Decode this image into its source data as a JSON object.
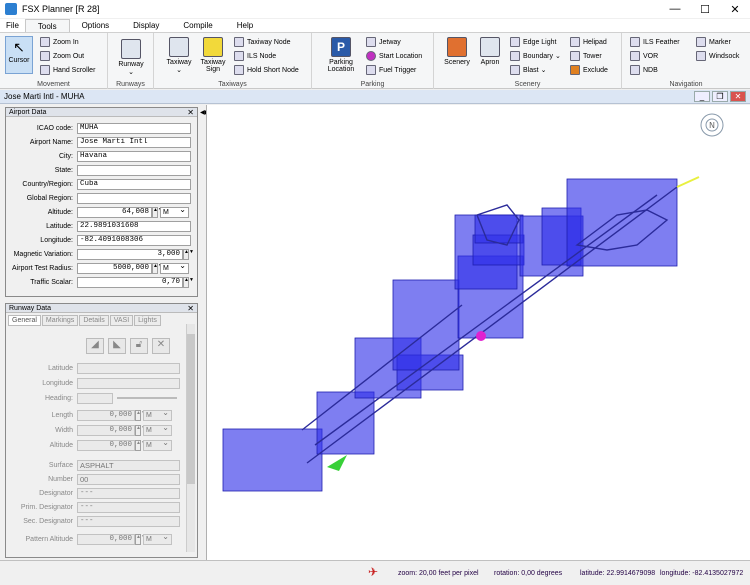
{
  "window": {
    "title": "FSX Planner [R 28]",
    "min": "—",
    "max": "☐",
    "close": "✕"
  },
  "menu": [
    "File",
    "Tools",
    "Options",
    "Display",
    "Compile",
    "Help"
  ],
  "ribbon": {
    "movement": {
      "label": "Movement",
      "cursor": "Cursor",
      "zoom_in": "Zoom In",
      "zoom_out": "Zoom Out",
      "hand": "Hand Scroller"
    },
    "runways": {
      "label": "Runways",
      "runway": "Runway"
    },
    "taxiways": {
      "label": "Taxiways",
      "taxiway": "Taxiway",
      "taxiway_sign": "Taxiway Sign",
      "taxiway_node": "Taxiway Node",
      "ils_node": "ILS Node",
      "hold_short": "Hold Short Node"
    },
    "parking": {
      "label": "Parking",
      "parking_location": "Parking Location",
      "jetway": "Jetway",
      "start_location": "Start Location",
      "fuel_trigger": "Fuel Trigger"
    },
    "scenery": {
      "label": "Scenery",
      "scenery": "Scenery",
      "apron": "Apron",
      "edge_light": "Edge Light",
      "boundary": "Boundary",
      "blast": "Blast",
      "helipad": "Helipad",
      "tower": "Tower",
      "exclude": "Exclude"
    },
    "navigation": {
      "label": "Navigation",
      "ils_feather": "ILS Feather",
      "vor": "VOR",
      "ndb": "NDB",
      "marker": "Marker",
      "windsock": "Windsock"
    }
  },
  "doc_title": "Jose Marti Intl - MUHA",
  "airport": {
    "header": "Airport Data",
    "fields": [
      {
        "label": "ICAO code:",
        "value": "MUHA"
      },
      {
        "label": "Airport Name:",
        "value": "Jose Marti Intl"
      },
      {
        "label": "City:",
        "value": "Havana"
      },
      {
        "label": "State:",
        "value": ""
      },
      {
        "label": "Country/Region:",
        "value": "Cuba"
      },
      {
        "label": "Global Region:",
        "value": ""
      },
      {
        "label": "Altitude:",
        "value": "64,008",
        "unit": "M"
      },
      {
        "label": "Latitude:",
        "value": "22.9891031608"
      },
      {
        "label": "Longitude:",
        "value": "-82.4091008306"
      },
      {
        "label": "Magnetic Variation:",
        "value": "3,000"
      },
      {
        "label": "Airport Test Radius:",
        "value": "5000,000",
        "unit": "M"
      },
      {
        "label": "Traffic Scalar:",
        "value": "0,70"
      }
    ]
  },
  "runway": {
    "header": "Runway Data",
    "tabs": [
      "General",
      "Markings",
      "Details",
      "VASI",
      "Lights"
    ],
    "fields": [
      {
        "label": "Latitude",
        "value": ""
      },
      {
        "label": "Longitude",
        "value": ""
      },
      {
        "label": "Heading:",
        "value": ""
      },
      {
        "label": "Length",
        "value": "0,000",
        "unit": "M"
      },
      {
        "label": "Width",
        "value": "0,000",
        "unit": "M"
      },
      {
        "label": "Altitude",
        "value": "0,000",
        "unit": "M"
      },
      {
        "label": "Surface",
        "value": "ASPHALT"
      },
      {
        "label": "Number",
        "value": "00"
      },
      {
        "label": "Designator",
        "value": "---"
      },
      {
        "label": "Prim. Designator",
        "value": "---"
      },
      {
        "label": "Sec. Designator",
        "value": "---"
      },
      {
        "label": "Pattern Altitude",
        "value": "0,000",
        "unit": "M"
      }
    ]
  },
  "status": {
    "zoom": "zoom: 20,00 feet per pixel",
    "rotation": "rotation: 0,00 degrees",
    "latitude": "latitude: 22.9914679098",
    "longitude": "longitude: -82.4135027972"
  }
}
